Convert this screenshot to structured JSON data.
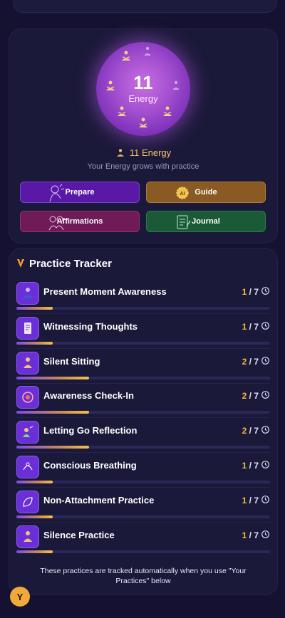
{
  "energy": {
    "value": "11",
    "label": "Energy",
    "summary": "11 Energy",
    "subtitle": "Your Energy grows with practice"
  },
  "actions": {
    "prepare": "Prepare",
    "guide": "Guide",
    "affirmations": "Affirmations",
    "journal": "Journal"
  },
  "tracker": {
    "title": "Practice Tracker",
    "items": [
      {
        "label": "Present Moment Awareness",
        "done": "1",
        "total": "/ 7",
        "progress": 0.143,
        "icon": "meditator-icon"
      },
      {
        "label": "Witnessing Thoughts",
        "done": "1",
        "total": "/ 7",
        "progress": 0.143,
        "icon": "notebook-icon"
      },
      {
        "label": "Silent Sitting",
        "done": "2",
        "total": "/ 7",
        "progress": 0.286,
        "icon": "sitting-icon"
      },
      {
        "label": "Awareness Check-In",
        "done": "2",
        "total": "/ 7",
        "progress": 0.286,
        "icon": "target-icon"
      },
      {
        "label": "Letting Go Reflection",
        "done": "2",
        "total": "/ 7",
        "progress": 0.286,
        "icon": "release-icon"
      },
      {
        "label": "Conscious Breathing",
        "done": "1",
        "total": "/ 7",
        "progress": 0.143,
        "icon": "breath-icon"
      },
      {
        "label": "Non-Attachment Practice",
        "done": "1",
        "total": "/ 7",
        "progress": 0.143,
        "icon": "leaf-icon"
      },
      {
        "label": "Silence Practice",
        "done": "1",
        "total": "/ 7",
        "progress": 0.143,
        "icon": "silence-icon"
      }
    ],
    "footnote": "These practices are tracked automatically when you use \"Your Practices\" below"
  },
  "user": {
    "avatar_initial": "Y"
  },
  "colors": {
    "accent_gold": "#f6b73c",
    "accent_purple": "#6a2fd6",
    "background": "#141230"
  }
}
